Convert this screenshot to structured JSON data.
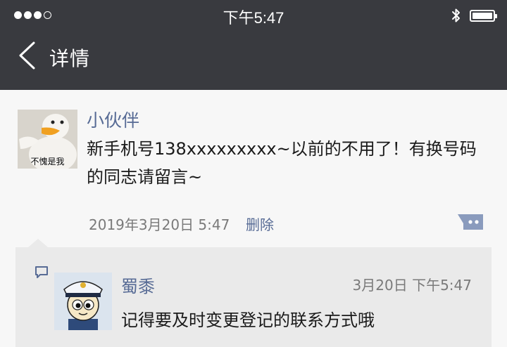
{
  "status_bar": {
    "time": "下午5:47",
    "signal_icon": "signal-dots-icon",
    "bluetooth_icon": "bluetooth-icon",
    "battery_icon": "battery-icon"
  },
  "nav": {
    "back_icon": "chevron-left-icon",
    "title": "详情"
  },
  "post": {
    "avatar_caption": "不愧是我",
    "name": "小伙伴",
    "text": "新手机号138xxxxxxxxx~以前的不用了！有换号码的同志请留言~",
    "time": "2019年3月20日  5:47",
    "delete_label": "删除",
    "comment_toggle_icon": "comment-toggle-icon"
  },
  "comments": [
    {
      "name": "蜀黍",
      "time": "3月20日  下午5:47",
      "text": "记得要及时变更登记的联系方式哦"
    }
  ],
  "colors": {
    "bar": "#393a3f",
    "link": "#576b95",
    "comment_bg": "#eaeaea",
    "page_bg": "#f7f7f7"
  }
}
